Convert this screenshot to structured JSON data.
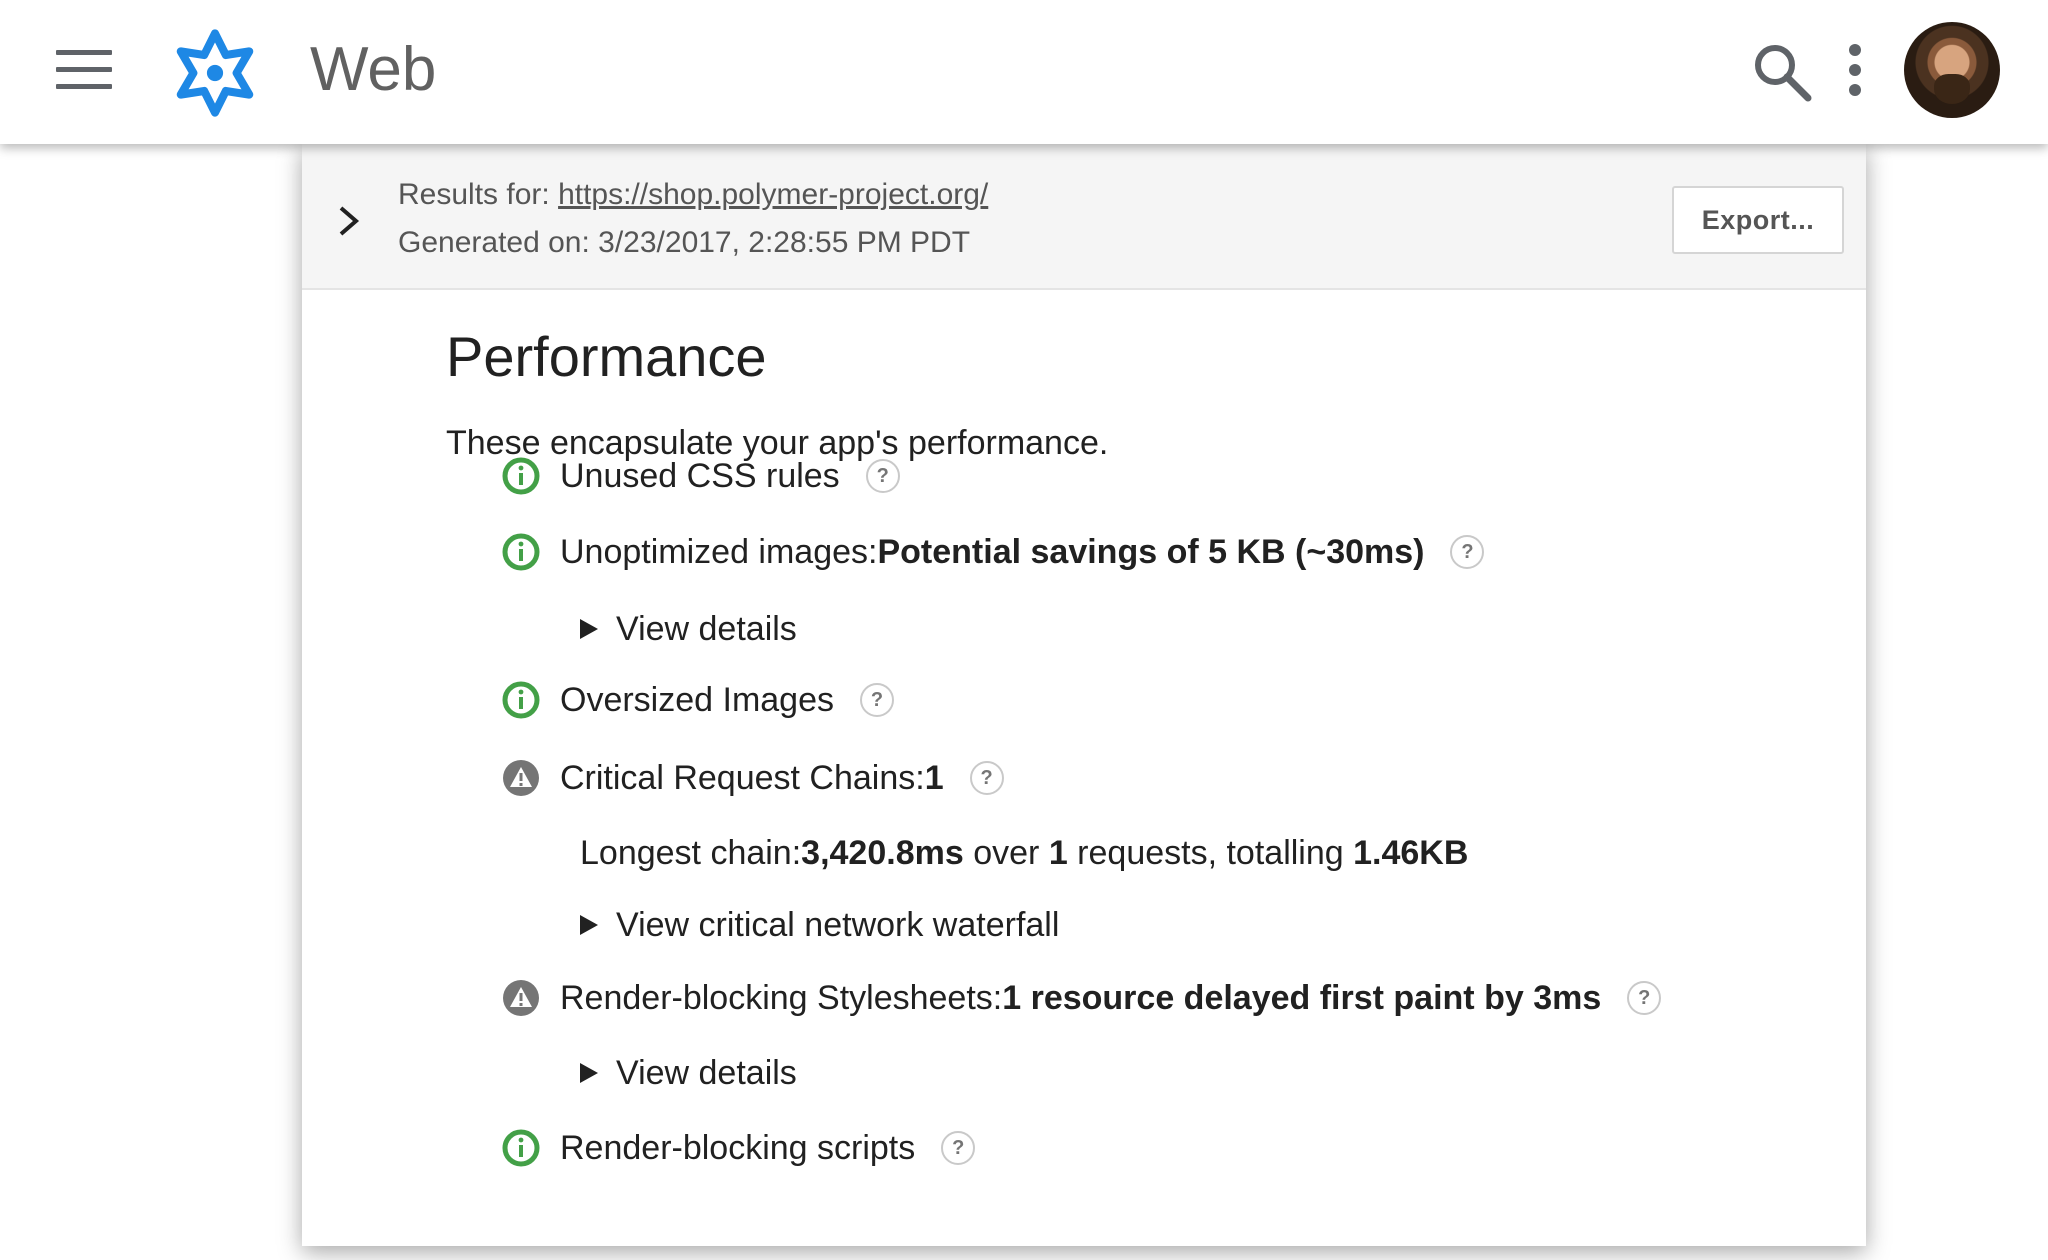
{
  "appbar": {
    "title": "Web",
    "icons": [
      "menu-icon",
      "logo-icon",
      "search-icon",
      "more-vert-icon",
      "avatar"
    ],
    "logo_color": "#1e88e5"
  },
  "report": {
    "results_label": "Results for:",
    "results_url": "https://shop.polymer-project.org/",
    "generated_label": "Generated on:",
    "generated_value": "3/23/2017, 2:28:55 PM PDT",
    "export_label": "Export..."
  },
  "section": {
    "title": "Performance",
    "description": "These encapsulate your app's performance."
  },
  "audits": [
    {
      "status": "pass",
      "label": "Unused CSS rules",
      "value": ""
    },
    {
      "status": "pass",
      "label": "Unoptimized images: ",
      "value": "Potential savings of 5 KB (~30ms)"
    },
    {
      "status": "pass",
      "label": "Oversized Images",
      "value": ""
    },
    {
      "status": "warn",
      "label": "Critical Request Chains: ",
      "value": "1"
    },
    {
      "status": "warn",
      "label": "Render-blocking Stylesheets: ",
      "value": "1 resource delayed first paint by 3ms"
    },
    {
      "status": "pass",
      "label": "Render-blocking scripts",
      "value": ""
    }
  ],
  "details": {
    "view_details": "View details",
    "longest_chain_prefix": "Longest chain: ",
    "longest_chain_ms": "3,420.8ms",
    "over": " over ",
    "requests_count": "1",
    "requests_totalling": " requests, totalling ",
    "total_size": "1.46KB",
    "view_waterfall": "View critical network waterfall"
  },
  "help_glyph": "?",
  "colors": {
    "pass": "#43a047",
    "warn": "#757575",
    "accent": "#1e88e5"
  }
}
